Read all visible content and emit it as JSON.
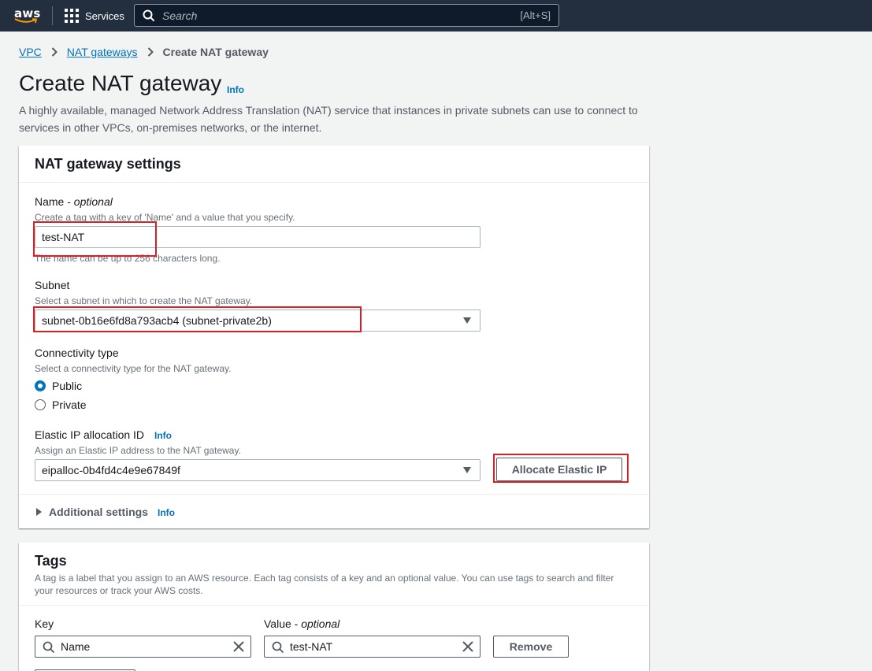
{
  "topnav": {
    "logo_text": "aws",
    "services_label": "Services",
    "search_placeholder": "Search",
    "search_shortcut": "[Alt+S]"
  },
  "breadcrumb": {
    "items": [
      "VPC",
      "NAT gateways"
    ],
    "current": "Create NAT gateway"
  },
  "page": {
    "title": "Create NAT gateway",
    "info": "Info",
    "description": "A highly available, managed Network Address Translation (NAT) service that instances in private subnets can use to connect to services in other VPCs, on-premises networks, or the internet."
  },
  "settings": {
    "header": "NAT gateway settings",
    "name": {
      "label": "Name - ",
      "label_optional": "optional",
      "description": "Create a tag with a key of 'Name' and a value that you specify.",
      "value": "test-NAT",
      "constraint": "The name can be up to 256 characters long."
    },
    "subnet": {
      "label": "Subnet",
      "description": "Select a subnet in which to create the NAT gateway.",
      "value": "subnet-0b16e6fd8a793acb4 (subnet-private2b)"
    },
    "connectivity": {
      "label": "Connectivity type",
      "description": "Select a connectivity type for the NAT gateway.",
      "options": [
        "Public",
        "Private"
      ],
      "selected": "Public"
    },
    "eip": {
      "label": "Elastic IP allocation ID",
      "info": "Info",
      "description": "Assign an Elastic IP address to the NAT gateway.",
      "value": "eipalloc-0b4fd4c4e9e67849f",
      "allocate_button": "Allocate Elastic IP"
    },
    "additional": {
      "label": "Additional settings",
      "info": "Info"
    }
  },
  "tags": {
    "header": "Tags",
    "description": "A tag is a label that you assign to an AWS resource. Each tag consists of a key and an optional value. You can use tags to search and filter your resources or track your AWS costs.",
    "key_label": "Key",
    "value_label": "Value - ",
    "value_optional": "optional",
    "rows": [
      {
        "key": "Name",
        "value": "test-NAT",
        "remove_label": "Remove"
      }
    ]
  },
  "colors": {
    "nav_bg": "#232f3e",
    "link": "#0073bb",
    "highlight": "#d91f26",
    "page_bg": "#f2f3f3"
  }
}
